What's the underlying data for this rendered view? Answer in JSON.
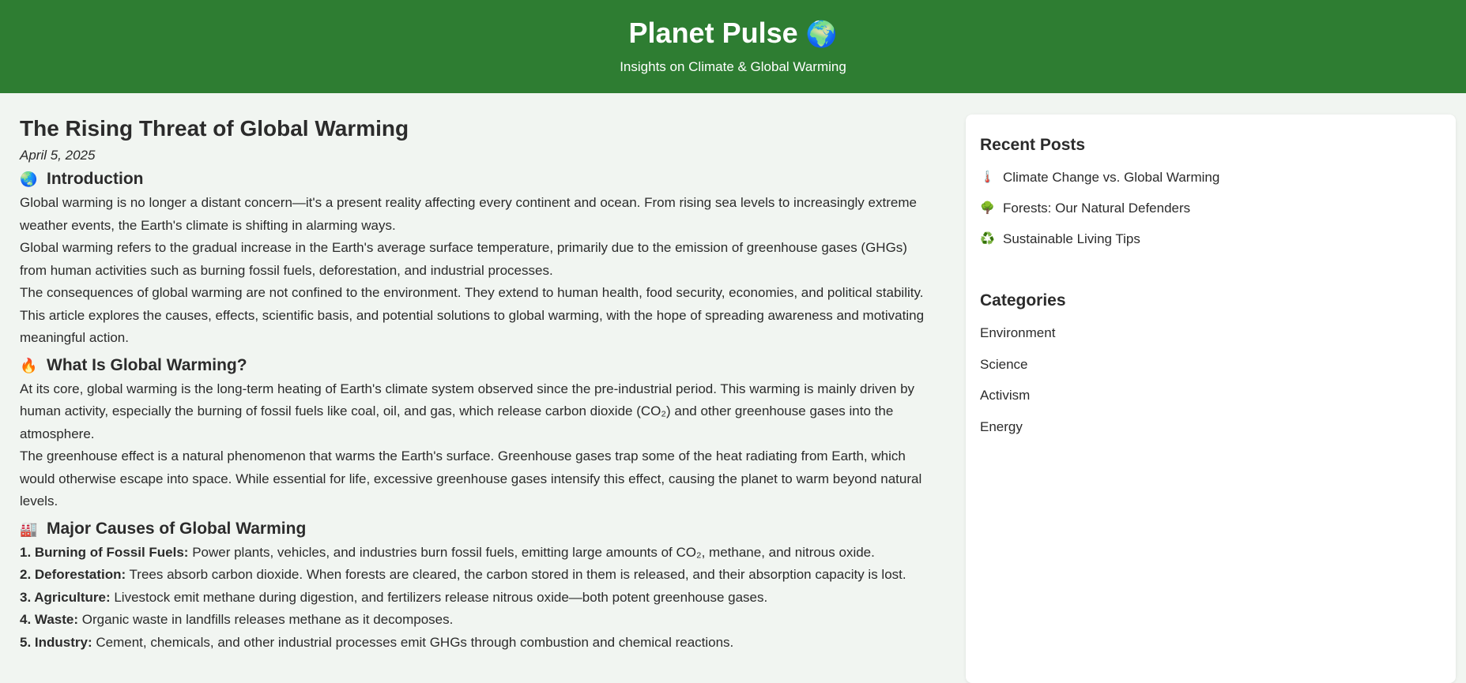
{
  "header": {
    "title": "Planet Pulse",
    "globe_icon": "🌍",
    "tagline": "Insights on Climate & Global Warming"
  },
  "article": {
    "title": "The Rising Threat of Global Warming",
    "date": "April 5, 2025",
    "sections": {
      "intro": {
        "icon": "🌏",
        "heading": "Introduction",
        "paragraphs": [
          "Global warming is no longer a distant concern—it's a present reality affecting every continent and ocean. From rising sea levels to increasingly extreme weather events, the Earth's climate is shifting in alarming ways.",
          "Global warming refers to the gradual increase in the Earth's average surface temperature, primarily due to the emission of greenhouse gases (GHGs) from human activities such as burning fossil fuels, deforestation, and industrial processes.",
          "The consequences of global warming are not confined to the environment. They extend to human health, food security, economies, and political stability. This article explores the causes, effects, scientific basis, and potential solutions to global warming, with the hope of spreading awareness and motivating meaningful action."
        ]
      },
      "what": {
        "icon": "🔥",
        "heading": "What Is Global Warming?",
        "paragraphs": [
          "At its core, global warming is the long-term heating of Earth's climate system observed since the pre-industrial period. This warming is mainly driven by human activity, especially the burning of fossil fuels like coal, oil, and gas, which release carbon dioxide (CO₂) and other greenhouse gases into the atmosphere.",
          "The greenhouse effect is a natural phenomenon that warms the Earth's surface. Greenhouse gases trap some of the heat radiating from Earth, which would otherwise escape into space. While essential for life, excessive greenhouse gases intensify this effect, causing the planet to warm beyond natural levels."
        ]
      },
      "causes": {
        "icon": "🏭",
        "heading": "Major Causes of Global Warming",
        "items": [
          {
            "label": "1. Burning of Fossil Fuels:",
            "text": " Power plants, vehicles, and industries burn fossil fuels, emitting large amounts of CO₂, methane, and nitrous oxide."
          },
          {
            "label": "2. Deforestation:",
            "text": " Trees absorb carbon dioxide. When forests are cleared, the carbon stored in them is released, and their absorption capacity is lost."
          },
          {
            "label": "3. Agriculture:",
            "text": " Livestock emit methane during digestion, and fertilizers release nitrous oxide—both potent greenhouse gases."
          },
          {
            "label": "4. Waste:",
            "text": " Organic waste in landfills releases methane as it decomposes."
          },
          {
            "label": "5. Industry:",
            "text": " Cement, chemicals, and other industrial processes emit GHGs through combustion and chemical reactions."
          }
        ]
      }
    }
  },
  "sidebar": {
    "recent_heading": "Recent Posts",
    "recent_posts": [
      {
        "icon": "🌡️",
        "label": "Climate Change vs. Global Warming"
      },
      {
        "icon": "🌳",
        "label": "Forests: Our Natural Defenders"
      },
      {
        "icon": "♻️",
        "label": "Sustainable Living Tips"
      }
    ],
    "categories_heading": "Categories",
    "categories": [
      "Environment",
      "Science",
      "Activism",
      "Energy"
    ]
  }
}
